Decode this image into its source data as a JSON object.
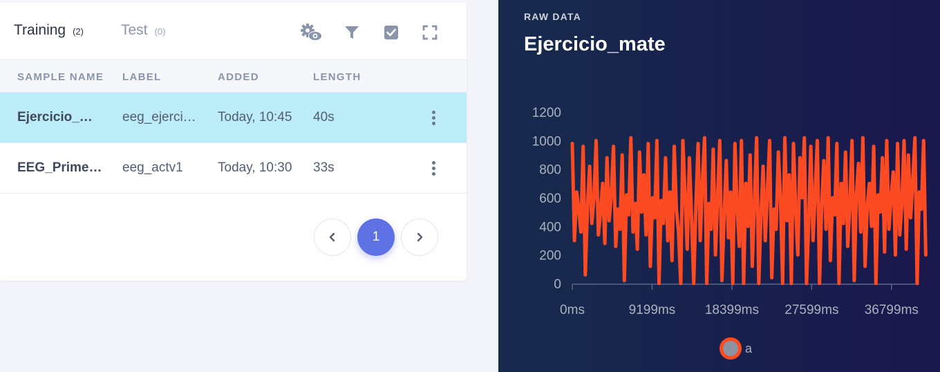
{
  "tabs": [
    {
      "label": "Training",
      "count": "(2)"
    },
    {
      "label": "Test",
      "count": "(0)"
    }
  ],
  "toolbar": [
    {
      "icon": "settings-eye-icon"
    },
    {
      "icon": "filter-icon"
    },
    {
      "icon": "check-square-icon"
    },
    {
      "icon": "fullscreen-icon"
    }
  ],
  "table": {
    "columns": [
      "SAMPLE NAME",
      "LABEL",
      "ADDED",
      "LENGTH"
    ],
    "rows": [
      {
        "name": "Ejercicio_mate",
        "label": "eeg_ejercicio",
        "added": "Today, 10:45",
        "length": "40s",
        "selected": true
      },
      {
        "name": "EEG_Primera_prueba",
        "label": "eeg_actv1",
        "added": "Today, 10:30",
        "length": "33s",
        "selected": false
      }
    ]
  },
  "pagination": {
    "current": "1"
  },
  "panel": {
    "kicker": "RAW DATA",
    "title": "Ejercicio_mate"
  },
  "colors": {
    "accent": "#5e72e4",
    "selected_row": "#bcecf7",
    "series": "#fc4b23"
  },
  "chart_data": {
    "type": "line",
    "title": "Ejercicio_mate",
    "xlabel": "",
    "ylabel": "",
    "x_ticks": [
      "0ms",
      "9199ms",
      "18399ms",
      "27599ms",
      "36799ms"
    ],
    "y_ticks": [
      0,
      200,
      400,
      600,
      800,
      1000,
      1200
    ],
    "xlim": [
      0,
      40000
    ],
    "ylim": [
      0,
      1200
    ],
    "legend": "bottom-center",
    "grid": false,
    "series": [
      {
        "name": "a",
        "color": "#fc4b23",
        "x_step_ms": 250,
        "values": [
          980,
          300,
          640,
          520,
          360,
          960,
          60,
          540,
          820,
          420,
          600,
          1000,
          340,
          500,
          700,
          280,
          880,
          440,
          620,
          960,
          260,
          520,
          380,
          900,
          20,
          620,
          480,
          1020,
          360,
          560,
          240,
          920,
          500,
          760,
          340,
          980,
          120,
          600,
          460,
          1000,
          0,
          580,
          420,
          880,
          300,
          640,
          160,
          960,
          520,
          360,
          0,
          1000,
          620,
          240,
          880,
          460,
          0,
          540,
          980,
          300,
          720,
          1020,
          0,
          560,
          380,
          940,
          200,
          600,
          1000,
          20,
          460,
          860,
          320,
          640,
          0,
          980,
          540,
          260,
          1000,
          0,
          700,
          400,
          900,
          120,
          580,
          1020,
          0,
          480,
          820,
          300,
          660,
          1000,
          40,
          520,
          380,
          920,
          600,
          0,
          1020,
          440,
          760,
          0,
          980,
          520,
          200,
          880,
          600,
          1020,
          0,
          420,
          960,
          300,
          640,
          1000,
          0,
          540,
          860,
          380,
          1020,
          160,
          600,
          480,
          980,
          0,
          700,
          420,
          920,
          260,
          560,
          1000,
          20,
          620,
          840,
          360,
          1020,
          120,
          540,
          700,
          400,
          960,
          0,
          620,
          500,
          880,
          220,
          1000,
          380,
          600,
          780,
          200,
          980,
          340,
          560,
          1000,
          240,
          900,
          460,
          720,
          1020,
          0,
          640,
          520,
          1000,
          200
        ]
      }
    ]
  }
}
